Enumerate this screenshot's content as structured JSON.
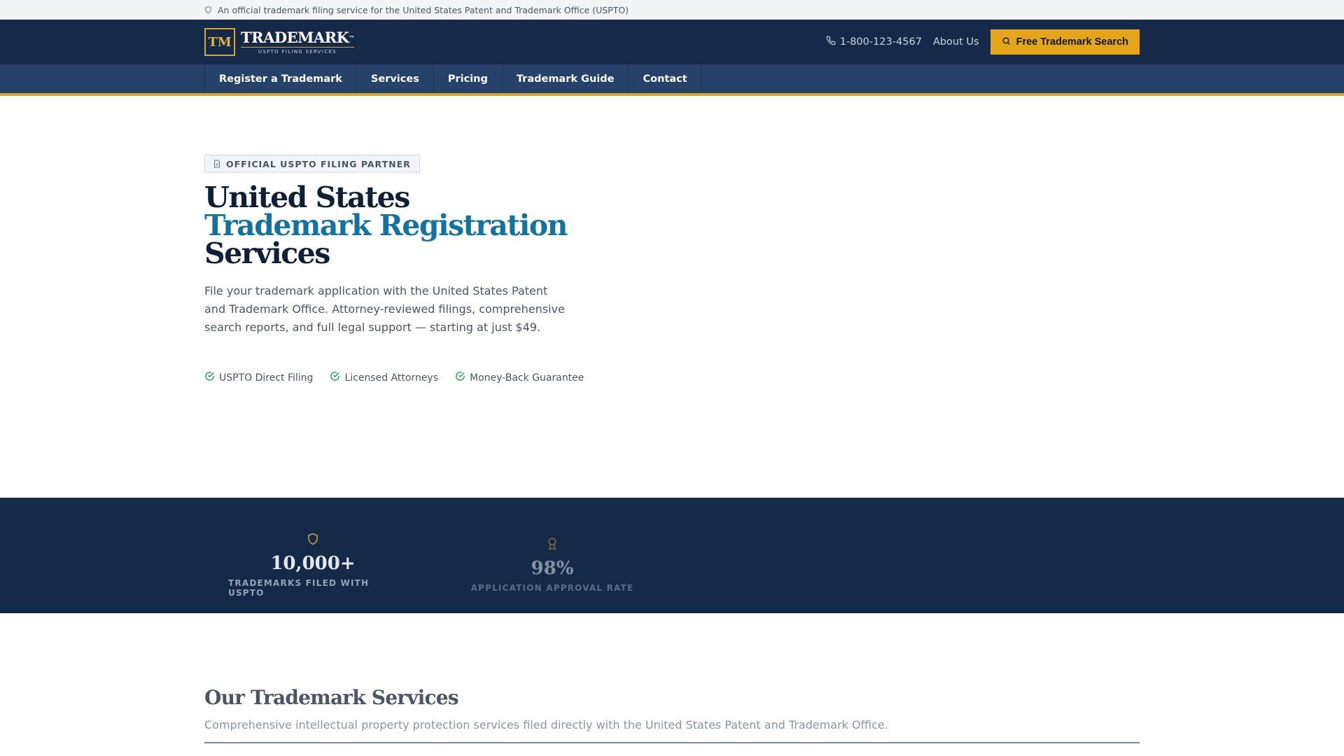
{
  "gov_banner": {
    "text": "An official trademark filing service for the United States Patent and Trademark Office (USPTO)",
    "icon": "shield-icon"
  },
  "header": {
    "logo": {
      "mark": "TM",
      "name": "TRADEMARK",
      "tm": "™",
      "sub": "USPTO FILING SERVICES"
    },
    "phone": "1-800-123-4567",
    "about": "About Us",
    "search_button": "Free Trademark Search"
  },
  "nav": {
    "items": [
      "Register a Trademark",
      "Services",
      "Pricing",
      "Trademark Guide",
      "Contact"
    ]
  },
  "hero": {
    "badge": "OFFICIAL USPTO FILING PARTNER",
    "title_line1": "United States",
    "title_line2": "Trademark Registration",
    "title_line3": "Services",
    "description": "File your trademark application with the United States Patent and Trademark Office. Attorney-reviewed filings, comprehensive search reports, and full legal support — starting at just $49.",
    "checks": [
      "USPTO Direct Filing",
      "Licensed Attorneys",
      "Money-Back Guarantee"
    ]
  },
  "stats": [
    {
      "icon": "shield-icon",
      "value": "10,000+",
      "label": "TRADEMARKS FILED WITH USPTO"
    },
    {
      "icon": "award-icon",
      "value": "98%",
      "label": "APPLICATION APPROVAL RATE"
    }
  ],
  "services": {
    "title": "Our Trademark Services",
    "subtitle": "Comprehensive intellectual property protection services filed directly with the United States Patent and Trademark Office."
  },
  "colors": {
    "navy": "#152a48",
    "nav_blue": "#26416a",
    "gold": "#e4a41c",
    "accent_blue": "#14729e",
    "check_green": "#16a34a"
  }
}
